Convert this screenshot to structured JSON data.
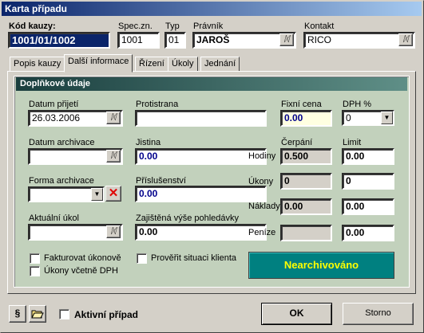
{
  "window": {
    "title": "Karta případu"
  },
  "header": {
    "kod_label": "Kód kauzy:",
    "kod_value": "1001/01/1002",
    "spec_label": "Spec.zn.",
    "spec_value": "1001",
    "typ_label": "Typ",
    "typ_value": "01",
    "pravnik_label": "Právník",
    "pravnik_value": "JAROŠ",
    "kontakt_label": "Kontakt",
    "kontakt_value": "RICO"
  },
  "tabs": [
    {
      "label": "Popis kauzy"
    },
    {
      "label": "Další informace"
    },
    {
      "label": "Řízení"
    },
    {
      "label": "Úkoly"
    },
    {
      "label": "Jednání"
    }
  ],
  "group": {
    "title": "Doplňkové údaje"
  },
  "fields": {
    "datum_prijeti_label": "Datum přijetí",
    "datum_prijeti_value": "26.03.2006",
    "protistrana_label": "Protistrana",
    "protistrana_value": "",
    "fixni_cena_label": "Fixní cena",
    "fixni_cena_value": "0.00",
    "dph_label": "DPH %",
    "dph_value": "0",
    "datum_archivace_label": "Datum archivace",
    "jistina_label": "Jistina",
    "jistina_value": "0.00",
    "cerpani_label": "Čerpání",
    "limit_label": "Limit",
    "hodiny_label": "Hodiny",
    "hodiny_cerpani": "0.500",
    "hodiny_limit": "0.00",
    "forma_archivace_label": "Forma archivace",
    "prislusenstvi_label": "Příslušenství",
    "prislusenstvi_value": "0.00",
    "ukony_label": "Úkony",
    "ukony_cerpani": "0",
    "ukony_limit": "0",
    "aktualni_ukol_label": "Aktuální úkol",
    "zajistena_label": "Zajištěná výše pohledávky",
    "zajistena_value": "0.00",
    "naklady_label": "Náklady",
    "naklady_cerpani": "0.00",
    "naklady_limit": "0.00",
    "penize_label": "Peníze",
    "penize_limit": "0.00"
  },
  "checkboxes": {
    "fakturovat": "Fakturovat úkonově",
    "ukony_dph": "Úkony včetně DPH",
    "proverit": "Prověřit situaci klienta"
  },
  "status": {
    "label": "Nearchivováno",
    "color": "#008080",
    "text_color": "#ffff00"
  },
  "footer": {
    "paragraph_icon": "§",
    "aktivni_label": "Aktivní případ",
    "ok_label": "OK",
    "storno_label": "Storno"
  }
}
